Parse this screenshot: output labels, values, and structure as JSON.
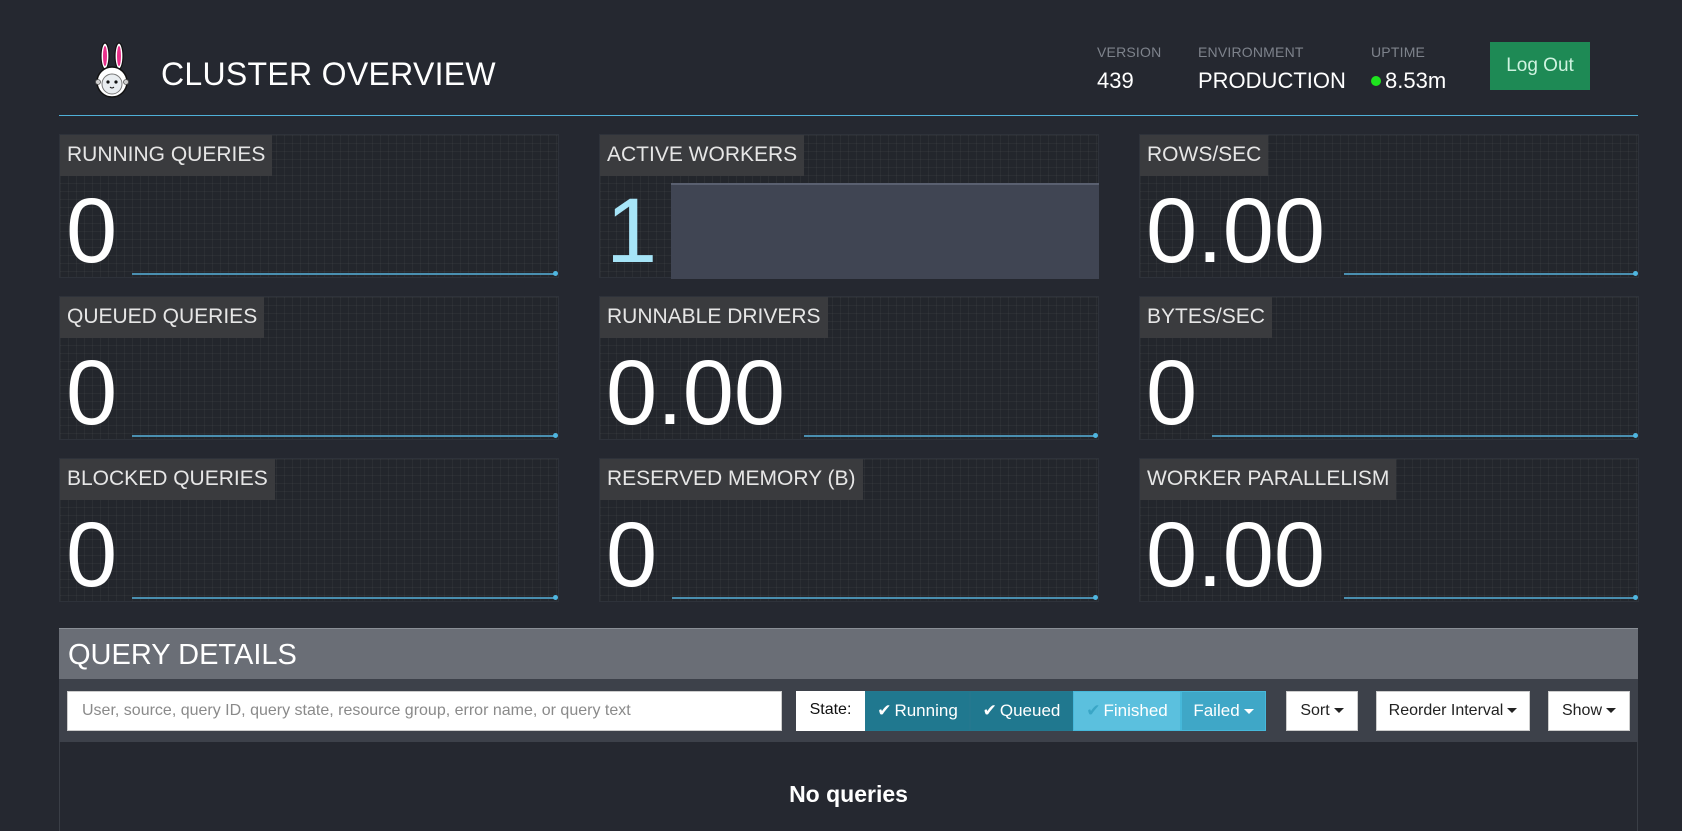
{
  "header": {
    "title": "CLUSTER OVERVIEW",
    "logo_icon": "bunny-astronaut-logo",
    "version": {
      "label": "VERSION",
      "value": "439"
    },
    "environment": {
      "label": "ENVIRONMENT",
      "value": "PRODUCTION"
    },
    "uptime": {
      "label": "UPTIME",
      "value": "8.53m",
      "status_color": "#1ee41e"
    },
    "logout_label": "Log Out"
  },
  "metrics": {
    "running_queries": {
      "label": "RUNNING QUERIES",
      "value": "0"
    },
    "active_workers": {
      "label": "ACTIVE WORKERS",
      "value": "1"
    },
    "rows_sec": {
      "label": "ROWS/SEC",
      "value": "0.00"
    },
    "queued_queries": {
      "label": "QUEUED QUERIES",
      "value": "0"
    },
    "runnable_drivers": {
      "label": "RUNNABLE DRIVERS",
      "value": "0.00"
    },
    "bytes_sec": {
      "label": "BYTES/SEC",
      "value": "0"
    },
    "blocked_queries": {
      "label": "BLOCKED QUERIES",
      "value": "0"
    },
    "reserved_memory": {
      "label": "RESERVED MEMORY (B)",
      "value": "0"
    },
    "worker_parallelism": {
      "label": "WORKER PARALLELISM",
      "value": "0.00"
    }
  },
  "query_details": {
    "title": "QUERY DETAILS",
    "search_placeholder": "User, source, query ID, query state, resource group, error name, or query text",
    "state_label": "State:",
    "state_filters": {
      "running": "Running",
      "queued": "Queued",
      "finished": "Finished",
      "failed": "Failed"
    },
    "sort_label": "Sort",
    "reorder_label": "Reorder Interval",
    "show_label": "Show",
    "empty_message": "No queries"
  },
  "colors": {
    "background": "#252830",
    "accent_line": "#4fb0d8",
    "logout_bg": "#1e8a55",
    "state_dark": "#20788f",
    "state_light": "#5bc0de"
  }
}
